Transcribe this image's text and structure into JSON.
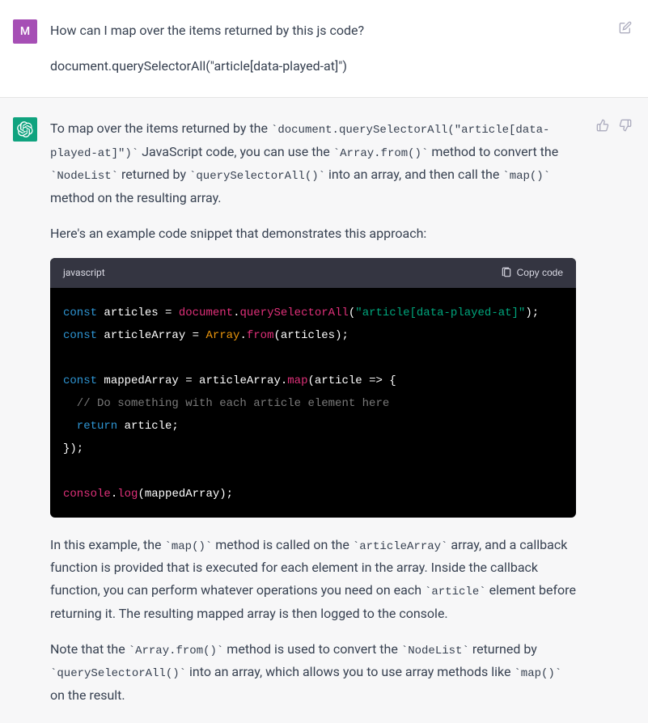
{
  "user": {
    "initial": "M",
    "line1": "How can I map over the items returned by this js code?",
    "line2": "document.querySelectorAll(\"article[data-played-at]\")"
  },
  "assistant": {
    "p1a": "To map over the items returned by the ",
    "p1_code1": "document.querySelectorAll(\"article[data-played-at]\")",
    "p1b": " JavaScript code, you can use the ",
    "p1_code2": "Array.from()",
    "p1c": " method to convert the ",
    "p1_code3": "NodeList",
    "p1d": " returned by ",
    "p1_code4": "querySelectorAll()",
    "p1e": " into an array, and then call the ",
    "p1_code5": "map()",
    "p1f": " method on the resulting array.",
    "p2": "Here's an example code snippet that demonstrates this approach:",
    "code": {
      "lang": "javascript",
      "copy_label": "Copy code",
      "l1_kw1": "const",
      "l1_v1": " articles = ",
      "l1_b1": "document",
      "l1_dot1": ".",
      "l1_m1": "querySelectorAll",
      "l1_open": "(",
      "l1_str": "\"article[data-played-at]\"",
      "l1_close": ");",
      "l2_kw1": "const",
      "l2_v1": " articleArray = ",
      "l2_b1": "Array",
      "l2_dot1": ".",
      "l2_m1": "from",
      "l2_open": "(articles);",
      "l4_kw1": "const",
      "l4_v1": " mappedArray = articleArray.",
      "l4_m1": "map",
      "l4_rest": "(article => {",
      "l5_comment": "  // Do something with each article element here",
      "l6_kw": "  return",
      "l6_rest": " article;",
      "l7": "});",
      "l9_b1": "console",
      "l9_dot": ".",
      "l9_m1": "log",
      "l9_rest": "(mappedArray);"
    },
    "p3a": "In this example, the ",
    "p3_code1": "map()",
    "p3b": " method is called on the ",
    "p3_code2": "articleArray",
    "p3c": " array, and a callback function is provided that is executed for each element in the array. Inside the callback function, you can perform whatever operations you need on each ",
    "p3_code3": "article",
    "p3d": " element before returning it. The resulting mapped array is then logged to the console.",
    "p4a": "Note that the ",
    "p4_code1": "Array.from()",
    "p4b": " method is used to convert the ",
    "p4_code2": "NodeList",
    "p4c": " returned by ",
    "p4_code3": "querySelectorAll()",
    "p4d": " into an array, which allows you to use array methods like ",
    "p4_code4": "map()",
    "p4e": " on the result."
  }
}
